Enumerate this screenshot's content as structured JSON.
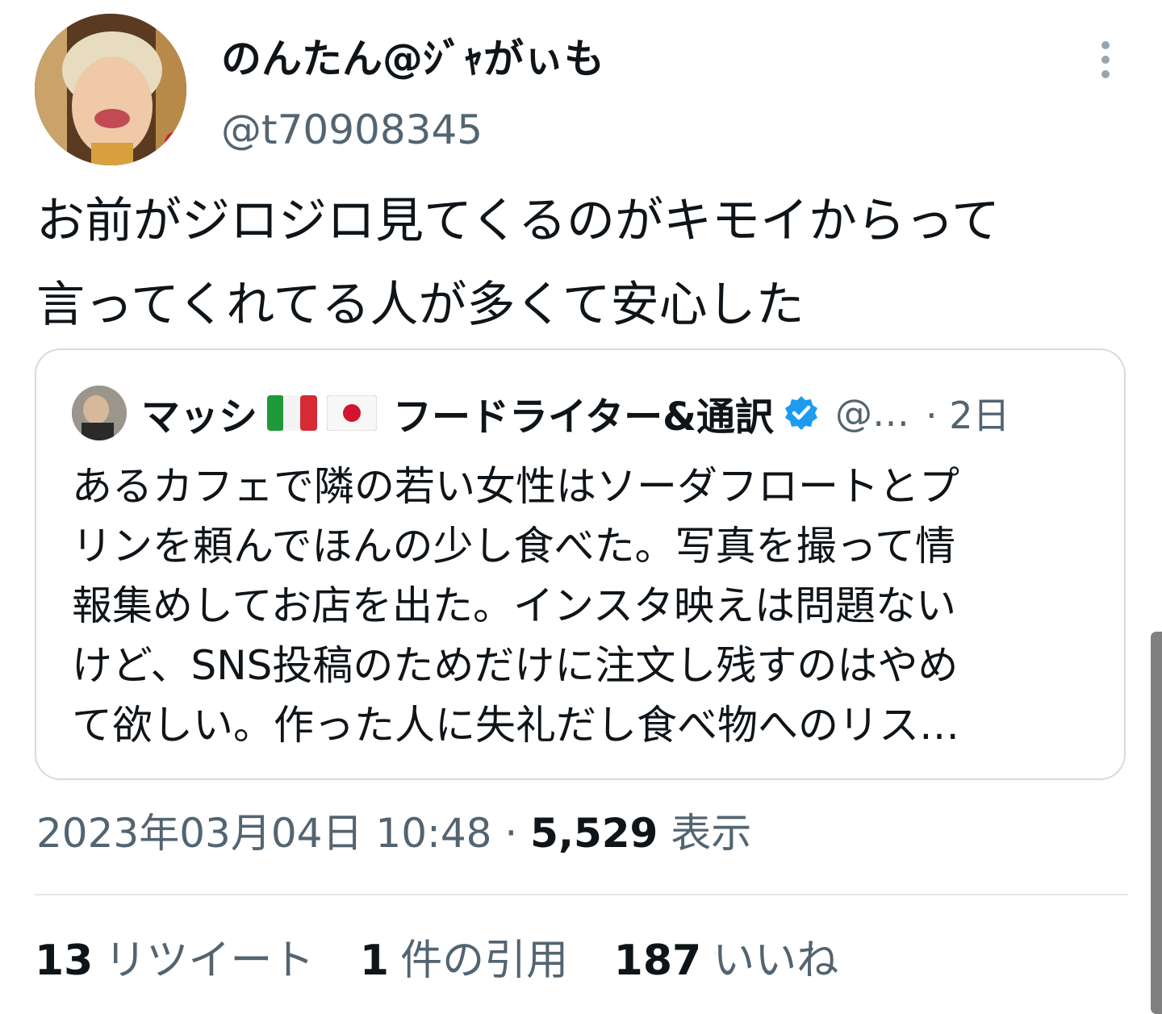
{
  "tweet": {
    "display_name": "のんたん@ｼﾞｬがぃも",
    "handle": "@t70908345",
    "text_lines": [
      "お前がジロジロ見てくるのがキモイからって",
      "言ってくれてる人が多くて安心した"
    ],
    "timestamp": "2023年03月04日 10:48",
    "separator": " · ",
    "views_count": "5,529",
    "views_label": "表示"
  },
  "quote": {
    "display_name": "マッシ",
    "name_suffix": "フードライター&通訳",
    "handle": "@…",
    "time": "· 2日",
    "text_lines": [
      "あるカフェで隣の若い女性はソーダフロートとプ",
      "リンを頼んでほんの少し食べた。写真を撮って情",
      "報集めしてお店を出た。インスタ映えは問題ない",
      "けど、SNS投稿のためだけに注文し残すのはやめ",
      "て欲しい。作った人に失礼だし食べ物へのリス…"
    ],
    "flags": [
      "italy-flag",
      "japan-flag"
    ],
    "verified_icon": "verified-badge-icon"
  },
  "stats": [
    {
      "count": "13",
      "label": "リツイート"
    },
    {
      "count": "1",
      "label": "件の引用"
    },
    {
      "count": "187",
      "label": "いいね"
    }
  ],
  "colors": {
    "text_primary": "#0f1419",
    "text_secondary": "#536471",
    "border": "#d6dbe0",
    "verified": "#1d9bf0"
  }
}
